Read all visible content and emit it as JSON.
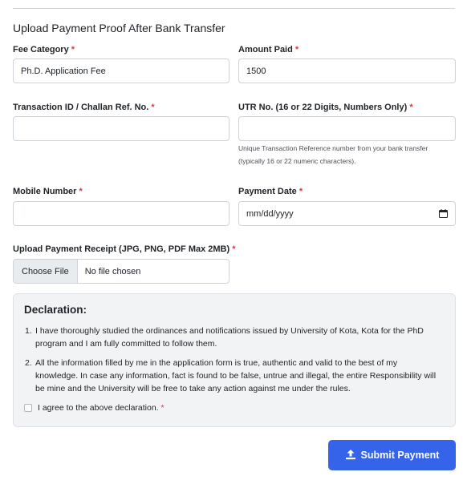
{
  "page_title": "Upload Payment Proof After Bank Transfer",
  "required_mark": "*",
  "fields": {
    "fee_category": {
      "label": "Fee Category",
      "value": "Ph.D. Application Fee"
    },
    "amount_paid": {
      "label": "Amount Paid",
      "value": "1500"
    },
    "transaction_id": {
      "label": "Transaction ID / Challan Ref. No.",
      "value": ""
    },
    "utr_no": {
      "label": "UTR No. (16 or 22 Digits, Numbers Only)",
      "value": "",
      "help_line1": "Unique Transaction Reference number from your bank transfer",
      "help_line2": "(typically 16 or 22 numeric characters)."
    },
    "mobile_number": {
      "label": "Mobile Number",
      "value": ""
    },
    "payment_date": {
      "label": "Payment Date",
      "value": "mm/dd/yyyy"
    },
    "receipt": {
      "label": "Upload Payment Receipt (JPG, PNG, PDF Max 2MB)",
      "button_label": "Choose File",
      "status": "No file chosen"
    }
  },
  "declaration": {
    "title": "Declaration:",
    "items": [
      {
        "num": "1.",
        "text": "I have thoroughly studied the ordinances and notifications issued by University of Kota, Kota for the PhD program and I am fully committed to follow them."
      },
      {
        "num": "2.",
        "text": "All the information filled by me in the application form is true, authentic and valid to the best of my knowledge. In case any information, fact is found to be false, untrue and illegal, the entire Responsibility will be mine and the University will be free to take any action against me under the rules."
      }
    ],
    "agree_label": "I agree to the above declaration.",
    "agree_checked": false
  },
  "submit_label": "Submit Payment",
  "icons": {
    "calendar": "calendar-icon",
    "upload": "upload-icon"
  },
  "colors": {
    "primary": "#3563e9",
    "required": "#dc3545",
    "declaration_bg": "#f1f3f5"
  }
}
